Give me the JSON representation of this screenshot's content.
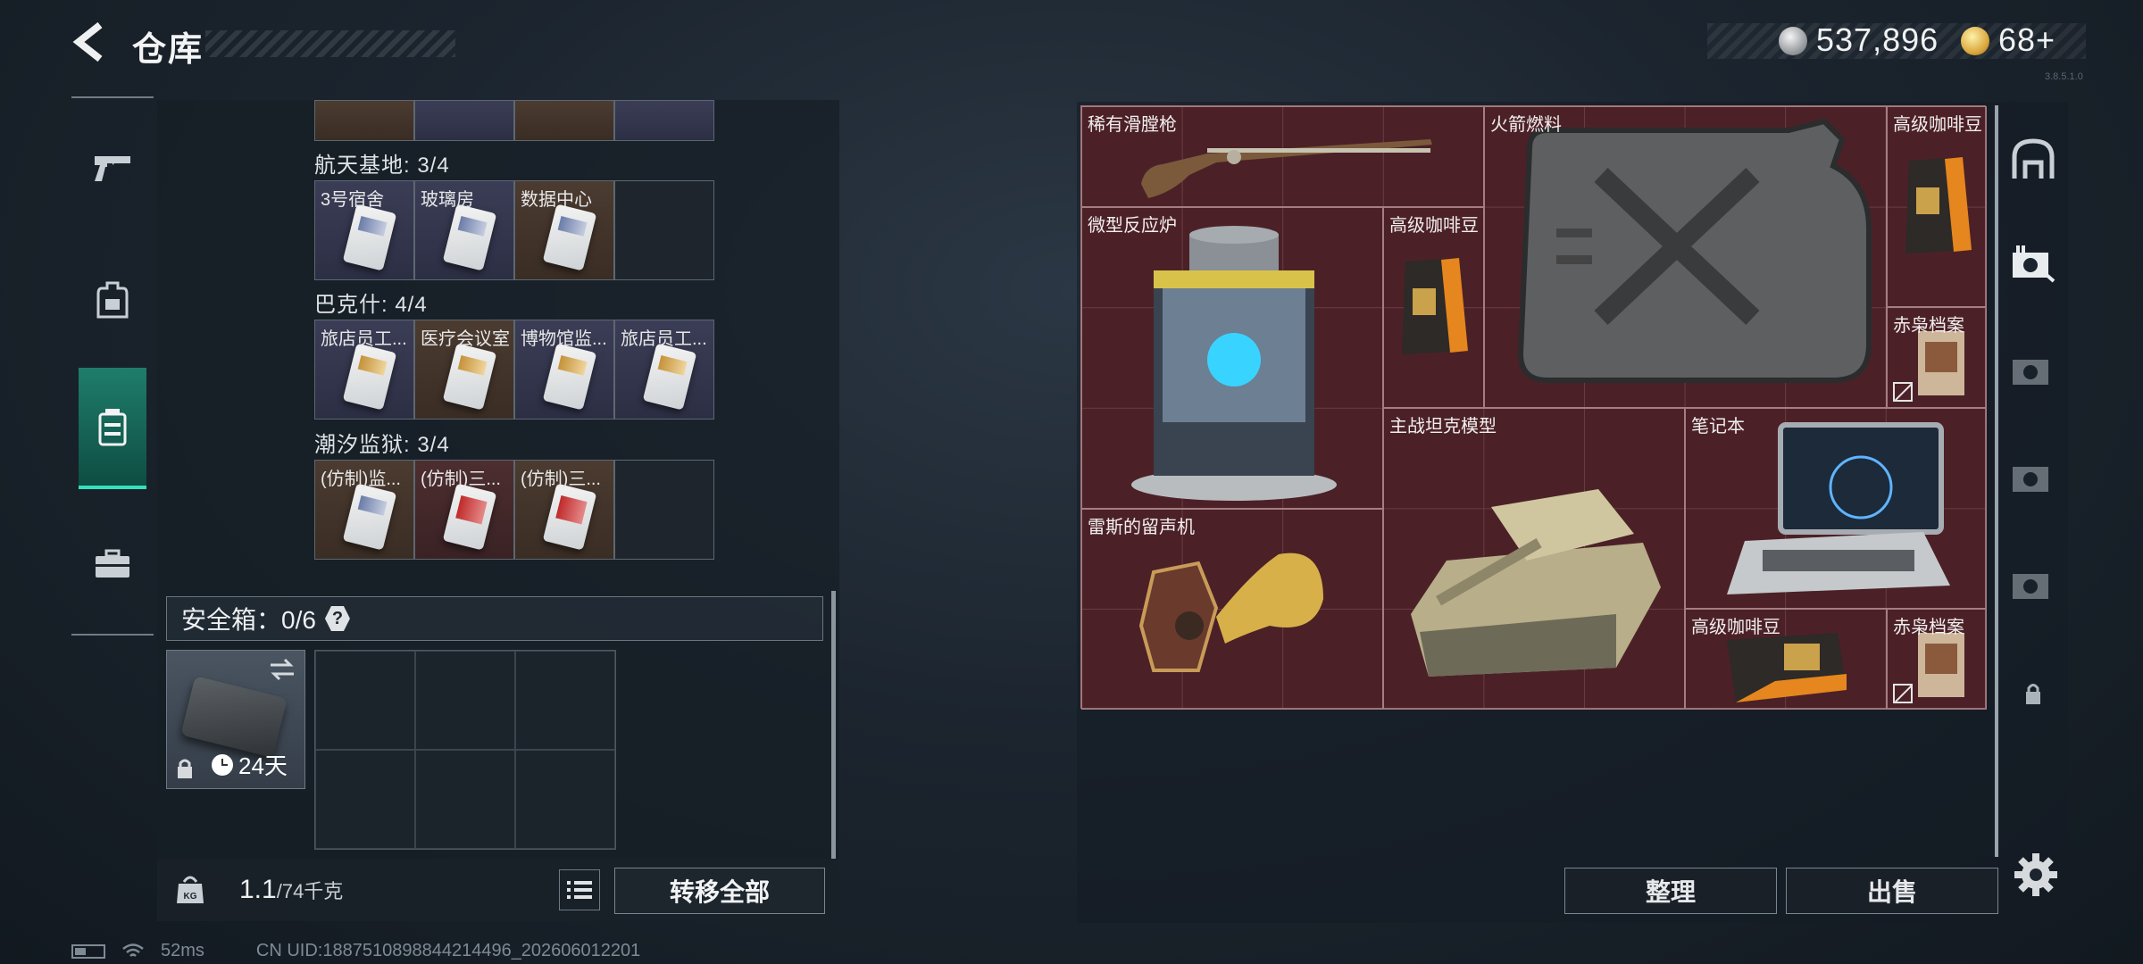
{
  "header": {
    "title": "仓库",
    "currency_primary": "537,896",
    "currency_secondary": "68+",
    "version": "3.8.5.1.0"
  },
  "left_nav": {
    "items": [
      {
        "name": "weapon",
        "icon": "gun-icon",
        "active": false
      },
      {
        "name": "equipment",
        "icon": "backpack-icon",
        "active": false
      },
      {
        "name": "items",
        "icon": "container-icon",
        "active": true
      },
      {
        "name": "toolbox",
        "icon": "briefcase-icon",
        "active": false
      }
    ]
  },
  "collections": [
    {
      "title": "航天基地: 3/4",
      "cells": [
        {
          "label": "3号宿舍",
          "bg": "purple",
          "card": "blue"
        },
        {
          "label": "玻璃房",
          "bg": "purple",
          "card": "blue"
        },
        {
          "label": "数据中心",
          "bg": "brown",
          "card": "blue"
        },
        {
          "label": "",
          "bg": "empty",
          "card": ""
        }
      ]
    },
    {
      "title": "巴克什: 4/4",
      "cells": [
        {
          "label": "旅店员工...",
          "bg": "purple",
          "card": "gold"
        },
        {
          "label": "医疗会议室",
          "bg": "brown",
          "card": "gold"
        },
        {
          "label": "博物馆监...",
          "bg": "purple",
          "card": "gold"
        },
        {
          "label": "旅店员工...",
          "bg": "purple",
          "card": "gold"
        }
      ]
    },
    {
      "title": "潮汐监狱: 3/4",
      "cells": [
        {
          "label": "(仿制)监...",
          "bg": "brown",
          "card": "blue"
        },
        {
          "label": "(仿制)三...",
          "bg": "red",
          "card": "red"
        },
        {
          "label": "(仿制)三...",
          "bg": "brown",
          "card": "red"
        },
        {
          "label": "",
          "bg": "empty",
          "card": ""
        }
      ]
    }
  ],
  "safe": {
    "label": "安全箱：0/6",
    "help": "?",
    "days": "24天"
  },
  "weight": {
    "current": "1.1",
    "max": "/74千克"
  },
  "buttons": {
    "transfer_all": "转移全部",
    "sort": "整理",
    "sell": "出售"
  },
  "stash_items": [
    {
      "label": "稀有滑膛枪",
      "kind": "musket"
    },
    {
      "label": "火箭燃料",
      "kind": "jerrycan"
    },
    {
      "label": "高级咖啡豆",
      "kind": "coffee"
    },
    {
      "label": "微型反应炉",
      "kind": "reactor"
    },
    {
      "label": "高级咖啡豆",
      "kind": "coffee"
    },
    {
      "label": "赤枭档案",
      "kind": "dossier"
    },
    {
      "label": "主战坦克模型",
      "kind": "tank"
    },
    {
      "label": "笔记本",
      "kind": "laptop"
    },
    {
      "label": "雷斯的留声机",
      "kind": "gramophone"
    },
    {
      "label": "高级咖啡豆",
      "kind": "coffee"
    },
    {
      "label": "赤枭档案",
      "kind": "dossier"
    }
  ],
  "footer": {
    "ping": "52ms",
    "uid": "CN UID:1887510898844214496_202606012201"
  }
}
